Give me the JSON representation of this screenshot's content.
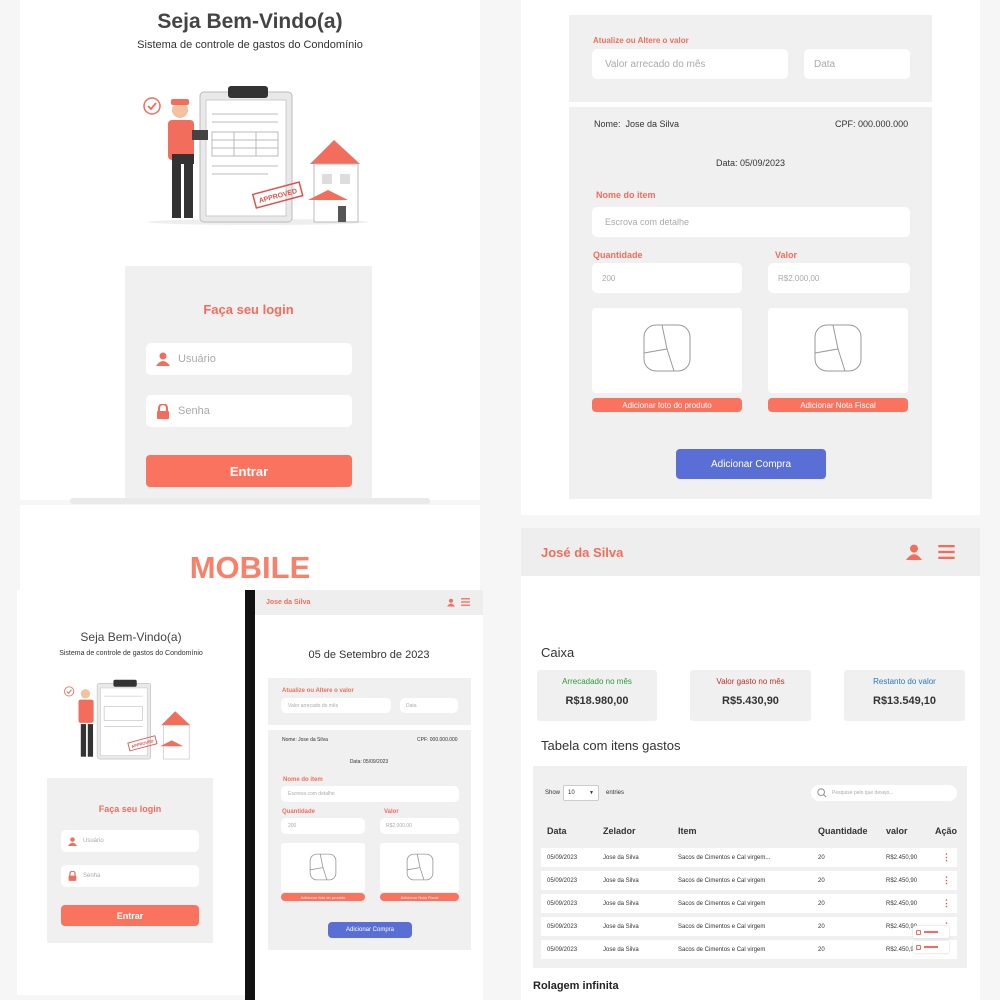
{
  "desktop_login": {
    "title": "Seja Bem-Vindo(a)",
    "subtitle": "Sistema de controle de gastos do Condomínio",
    "login_title": "Faça seu login",
    "user_placeholder": "Usuário",
    "pass_placeholder": "Senha",
    "enter_label": "Entrar",
    "approved_stamp": "APPROVED"
  },
  "mobile_label": "MOBILE",
  "mobile_login": {
    "title": "Seja Bem-Vindo(a)",
    "subtitle": "Sistema de controle de gastos do Condomínio",
    "login_title": "Faça seu login",
    "user_placeholder": "Usuário",
    "pass_placeholder": "Senha",
    "enter_label": "Entrar",
    "approved_stamp": "APPROVED"
  },
  "mobile_form": {
    "header_name": "Jose da Silva",
    "date_title": "05 de Setembro de 2023",
    "update_label": "Atualize ou Altere o valor",
    "value_placeholder": "Valor arrecado do mês",
    "date_placeholder": "Data",
    "name_label": "Nome:",
    "name_value": "Jose da Silva",
    "cpf_label": "CPF:",
    "cpf_value": "000.000.000",
    "date_line": "Data: 05/09/2023",
    "item_label": "Nome do item",
    "item_placeholder": "Escreva com detalhe",
    "qty_label": "Quantidade",
    "qty_placeholder": "200",
    "val_label": "Valor",
    "val_placeholder": "R$2.000,00",
    "photo_label": "Adicionar foto do produto",
    "invoice_label": "Adicionar Nota Fiscal",
    "add_label": "Adicionar Compra"
  },
  "desktop_form": {
    "update_label": "Atualize ou Altere o valor",
    "value_placeholder": "Valor arrecado do mês",
    "date_placeholder": "Data",
    "name_label": "Nome:",
    "name_value": "Jose da Silva",
    "cpf_label": "CPF:",
    "cpf_value": "000.000.000",
    "date_line": "Data: 05/09/2023",
    "item_label": "Nome do item",
    "item_placeholder": "Escrova com detalhe",
    "qty_label": "Quantidade",
    "qty_placeholder": "200",
    "val_label": "Valor",
    "val_placeholder": "R$2.000,00",
    "photo_label": "Adicionar foto do produto",
    "invoice_label": "Adicionar Nota Fiscal",
    "add_label": "Adicionar Compra"
  },
  "dashboard": {
    "header_name": "José da Silva",
    "caixa_title": "Caixa",
    "cards": [
      {
        "label": "Arrecadado no mês",
        "value": "R$18.980,00",
        "color": "#2e9a3a"
      },
      {
        "label": "Valor gasto no mês",
        "value": "R$5.430,90",
        "color": "#c0302a"
      },
      {
        "label": "Restanto do valor",
        "value": "R$13.549,10",
        "color": "#2a78b8"
      }
    ],
    "table_title": "Tabela com itens gastos",
    "show_label": "Show",
    "show_value": "10",
    "entries_label": "entries",
    "search_placeholder": "Pesquise pelo que desejo...",
    "columns": [
      "Data",
      "Zelador",
      "Item",
      "Quantidade",
      "valor",
      "Ação"
    ],
    "rows": [
      [
        "05/09/2023",
        "Jose da Silva",
        "Sacos de Cimentos e Cal virgem...",
        "20",
        "R$2.450,90"
      ],
      [
        "05/09/2023",
        "Jose da Silva",
        "Sacos de Cimentos e Cal virgem",
        "20",
        "R$2.450,90"
      ],
      [
        "05/09/2023",
        "Jose da Silva",
        "Sacos de Cimentos e Cal virgem",
        "20",
        "R$2.450,90"
      ],
      [
        "05/09/2023",
        "Jose da Silva",
        "Sacos de Cimentos e Cal virgem",
        "20",
        "R$2.450,90"
      ],
      [
        "05/09/2023",
        "Jose da Silva",
        "Sacos de Cimentos e Cal virgem",
        "20",
        "R$2.450,90"
      ]
    ],
    "footer_note": "Rolagem infinita"
  },
  "colors": {
    "accent": "#f9735e",
    "primary_blue": "#5a6fd6",
    "panel_gray": "#f0f0f0"
  }
}
